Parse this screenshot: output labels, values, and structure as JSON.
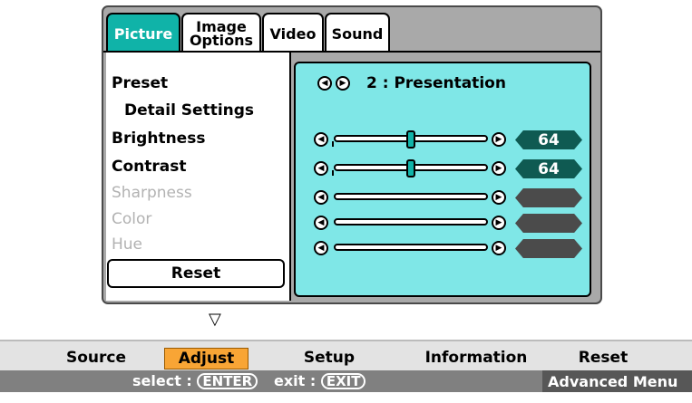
{
  "tabs": [
    {
      "label": "Picture",
      "active": true
    },
    {
      "label": "Image\nOptions",
      "active": false
    },
    {
      "label": "Video",
      "active": false
    },
    {
      "label": "Sound",
      "active": false
    }
  ],
  "left_menu": {
    "preset": "Preset",
    "detail_settings": "Detail Settings",
    "brightness": "Brightness",
    "contrast": "Contrast",
    "sharpness": "Sharpness",
    "color": "Color",
    "hue": "Hue",
    "reset": "Reset"
  },
  "right_panel": {
    "preset_value": "2 : Presentation",
    "sliders": [
      {
        "name": "brightness",
        "value": "64",
        "level": 0.5,
        "enabled": true
      },
      {
        "name": "contrast",
        "value": "64",
        "level": 0.5,
        "enabled": true
      },
      {
        "name": "sharpness",
        "value": "",
        "level": null,
        "enabled": false
      },
      {
        "name": "color",
        "value": "",
        "level": null,
        "enabled": false
      },
      {
        "name": "hue",
        "value": "",
        "level": null,
        "enabled": false
      }
    ]
  },
  "main_menu": {
    "items": [
      "Source",
      "Adjust",
      "Setup",
      "Information",
      "Reset"
    ],
    "active": "Adjust"
  },
  "status": {
    "select_label": "select :",
    "select_key": "ENTER",
    "exit_label": "exit :",
    "exit_key": "EXIT",
    "advanced": "Advanced Menu"
  },
  "colors": {
    "active_tab": "#10b3a8",
    "panel_bg": "#7fe7e7",
    "value_active": "#0f5a52",
    "menu_active": "#f8a535"
  }
}
